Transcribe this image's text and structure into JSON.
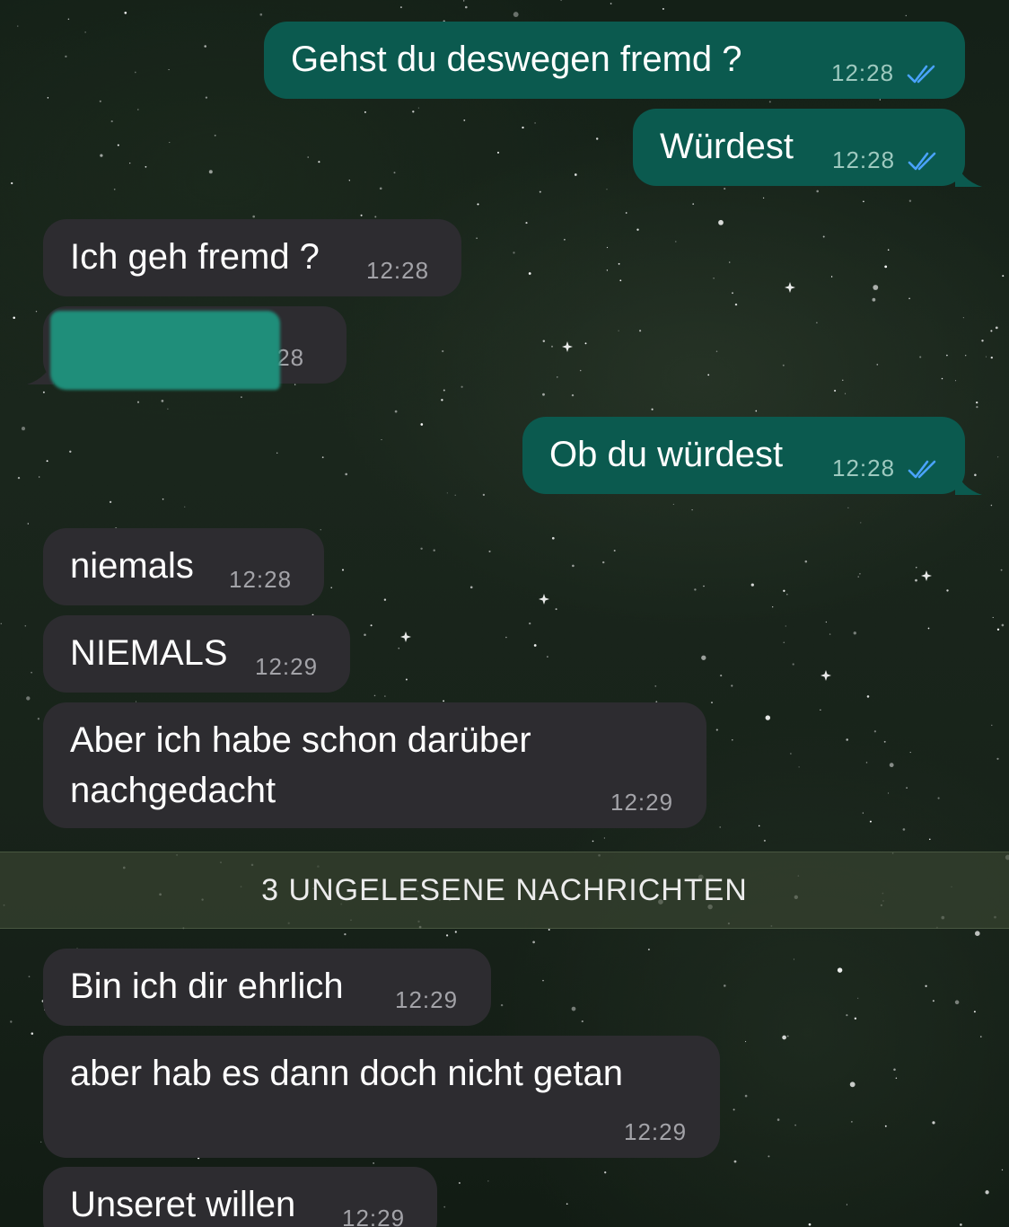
{
  "colors": {
    "incoming_bubble": "#2d2c30",
    "outgoing_bubble": "#0b5a4f",
    "read_ticks": "#4aa3ff",
    "redaction": "#1f8e7a"
  },
  "icons": {
    "read_receipt": "double-check-icon"
  },
  "messages": [
    {
      "direction": "outgoing",
      "text": "Gehst du deswegen fremd ?",
      "time": "12:28",
      "status": "read"
    },
    {
      "direction": "outgoing",
      "text": "Würdest",
      "time": "12:28",
      "status": "read"
    },
    {
      "direction": "incoming",
      "text": "Ich geh fremd ?",
      "time": "12:28"
    },
    {
      "direction": "incoming",
      "text": "",
      "time": ":28",
      "redacted": true
    },
    {
      "direction": "outgoing",
      "text": "Ob du würdest",
      "time": "12:28",
      "status": "read"
    },
    {
      "direction": "incoming",
      "text": "niemals",
      "time": "12:28"
    },
    {
      "direction": "incoming",
      "text": "NIEMALS",
      "time": "12:29"
    },
    {
      "direction": "incoming",
      "text_line1": "Aber ich habe schon darüber",
      "text_line2": "nachgedacht",
      "time": "12:29"
    }
  ],
  "unread_divider": {
    "label": "3 UNGELESENE NACHRICHTEN"
  },
  "unread_messages": [
    {
      "direction": "incoming",
      "text": "Bin ich dir ehrlich",
      "time": "12:29"
    },
    {
      "direction": "incoming",
      "text": "aber hab es dann doch nicht getan",
      "time": "12:29"
    },
    {
      "direction": "incoming",
      "text": "Unseret willen",
      "time": "12:29"
    }
  ]
}
